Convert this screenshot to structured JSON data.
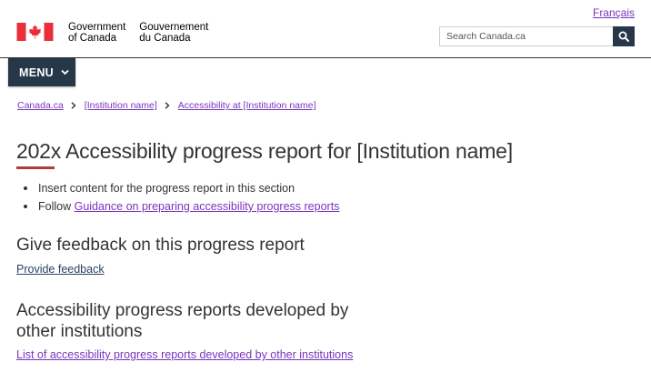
{
  "header": {
    "language_link": "Français",
    "signature_en_line1": "Government",
    "signature_en_line2": "of Canada",
    "signature_fr_line1": "Gouvernement",
    "signature_fr_line2": "du Canada",
    "search_placeholder": "Search Canada.ca",
    "flag_colors": {
      "red": "#eb2d37",
      "white": "#ffffff"
    }
  },
  "menu": {
    "label": "MENU",
    "icon": "chevron-down-icon",
    "bg_color": "#26374a"
  },
  "breadcrumb": [
    "Canada.ca",
    "[Institution name]",
    "Accessibility at [Institution name]"
  ],
  "page": {
    "title": "202x Accessibility progress report for [Institution name]",
    "accent_color": "#af3c43",
    "bullets": {
      "item1": "Insert content for the progress report in this section",
      "item2_prefix": "Follow",
      "item2_link": "Guidance on preparing accessibility progress reports"
    },
    "feedback": {
      "heading": "Give feedback on this progress report",
      "link": "Provide feedback"
    },
    "others": {
      "heading": "Accessibility progress reports developed by other institutions",
      "link": "List of accessibility progress reports developed by other institutions"
    }
  }
}
